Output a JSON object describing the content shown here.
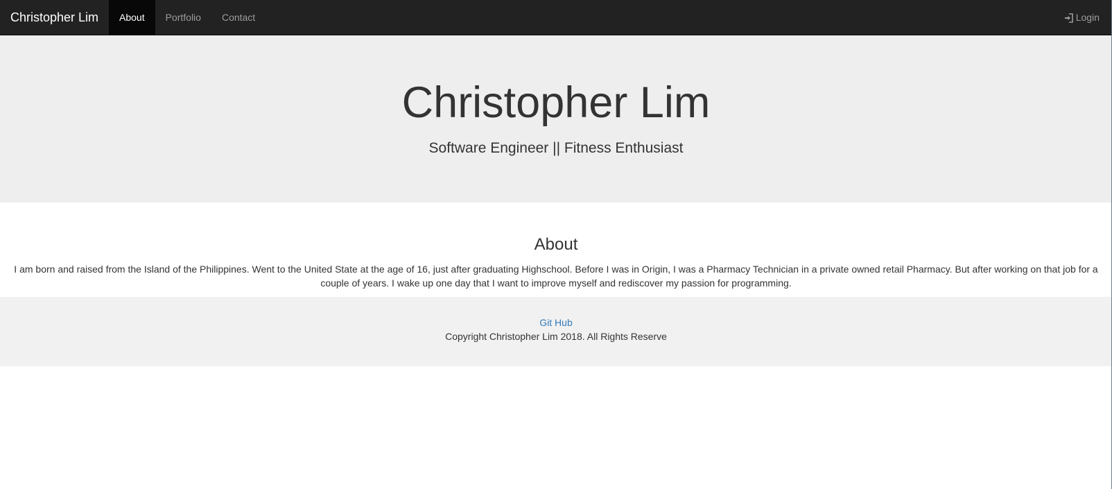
{
  "navbar": {
    "brand": "Christopher Lim",
    "items": [
      {
        "label": "About",
        "active": true
      },
      {
        "label": "Portfolio",
        "active": false
      },
      {
        "label": "Contact",
        "active": false
      }
    ],
    "login_label": "Login",
    "login_icon": "login-icon"
  },
  "hero": {
    "title": "Christopher Lim",
    "subtitle": "Software Engineer || Fitness Enthusiast"
  },
  "about": {
    "heading": "About",
    "text": "I am born and raised from the Island of the Philippines. Went to the United State at the age of 16, just after graduating Highschool. Before I was in Origin, I was a Pharmacy Technician in a private owned retail Pharmacy. But after working on that job for a couple of years. I wake up one day that I want to improve myself and rediscover my passion for programming."
  },
  "footer": {
    "link_label": "Git Hub",
    "copyright": "Copyright Christopher Lim 2018. All Rights Reserve"
  },
  "colors": {
    "navbar_bg": "#222222",
    "active_bg": "#080808",
    "jumbotron_bg": "#eeeeee",
    "footer_bg": "#f1f1f1",
    "link": "#337ab7"
  }
}
